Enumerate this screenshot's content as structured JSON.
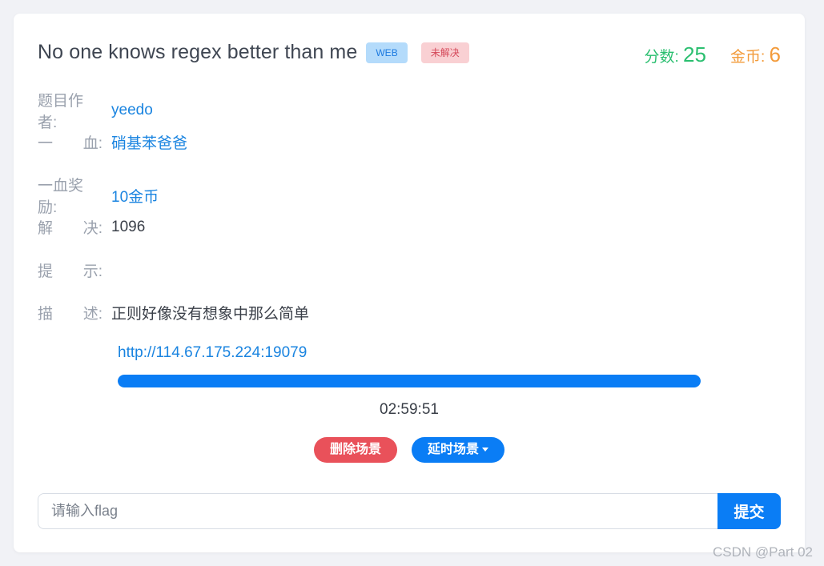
{
  "challenge": {
    "title": "No one knows regex better than me",
    "category_badge": "WEB",
    "status_badge": "未解决",
    "score_label": "分数:",
    "score_value": "25",
    "coin_label": "金币:",
    "coin_value": "6"
  },
  "info": {
    "author": {
      "label_a": "题目作者:",
      "value": "yeedo"
    },
    "first_blood": {
      "label_a": "一",
      "label_b": "血:",
      "value": "硝基苯爸爸"
    },
    "first_blood_reward": {
      "label_a": "一血奖励:",
      "value": "10金币"
    },
    "solves": {
      "label_a": "解",
      "label_b": "决:",
      "value": "1096"
    },
    "hint": {
      "label_a": "提",
      "label_b": "示:",
      "value": ""
    },
    "description": {
      "label_a": "描",
      "label_b": "述:",
      "value": "正则好像没有想象中那么简单"
    }
  },
  "scene": {
    "url": "http://114.67.175.224:19079",
    "progress_fraction": 1.0,
    "timer": "02:59:51",
    "delete_label": "删除场景",
    "extend_label": "延时场景"
  },
  "flag_form": {
    "placeholder": "请输入flag",
    "value": "",
    "submit_label": "提交"
  },
  "watermark": "CSDN @Part 02",
  "colors": {
    "accent": "#0a7df5",
    "score": "#2bbf70",
    "coin": "#f39b3b",
    "danger": "#e9515a"
  }
}
